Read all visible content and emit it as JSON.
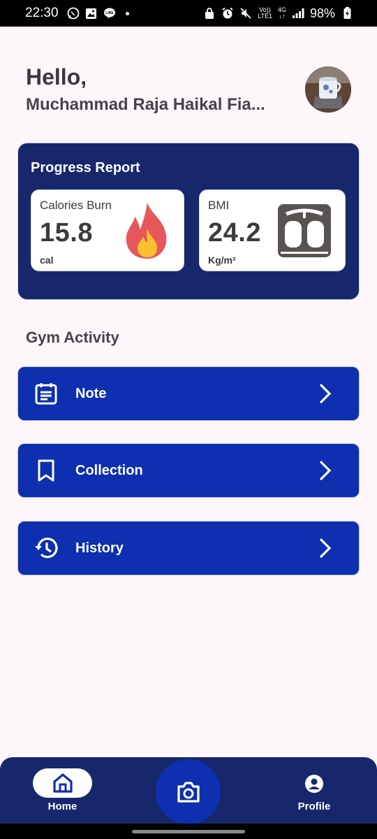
{
  "status_bar": {
    "time": "22:30",
    "left_icons": [
      "whatsapp-icon",
      "gallery-icon",
      "line-icon"
    ],
    "network_top": "Vo))",
    "network_bottom": "LTE1",
    "network_type": "4G",
    "battery": "98%"
  },
  "header": {
    "greeting": "Hello,",
    "user_name": "Muchammad Raja Haikal Fia..."
  },
  "progress_report": {
    "title": "Progress Report",
    "calories": {
      "label": "Calories Burn",
      "value": "15.8",
      "unit": "cal",
      "icon": "fire-icon"
    },
    "bmi": {
      "label": "BMI",
      "value": "24.2",
      "unit": "Kg/m²",
      "icon": "scale-icon"
    }
  },
  "gym_activity": {
    "title": "Gym Activity",
    "items": [
      {
        "label": "Note",
        "icon": "note-icon"
      },
      {
        "label": "Collection",
        "icon": "bookmark-icon"
      },
      {
        "label": "History",
        "icon": "history-icon"
      }
    ]
  },
  "bottom_nav": {
    "home_label": "Home",
    "profile_label": "Profile",
    "camera_icon": "camera-icon"
  },
  "colors": {
    "primary_dark": "#16286b",
    "primary": "#0d2fb0",
    "background": "#fdf7fb"
  }
}
